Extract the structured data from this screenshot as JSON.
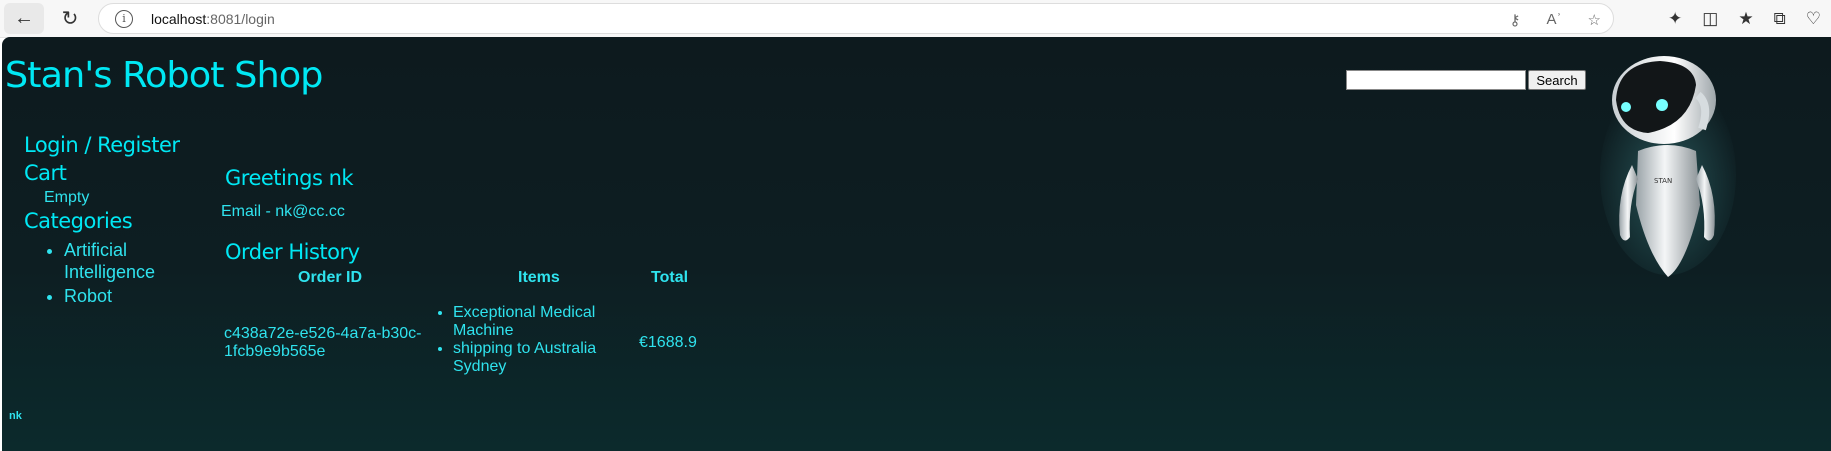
{
  "browser": {
    "url_host": "localhost",
    "url_rest": ":8081/login"
  },
  "site": {
    "title": "Stan's Robot Shop",
    "search_button": "Search",
    "search_value": ""
  },
  "sidebar": {
    "login": "Login / Register",
    "cart": "Cart",
    "cart_status": "Empty",
    "categories_heading": "Categories",
    "categories": [
      {
        "label": "Artificial Intelligence"
      },
      {
        "label": "Robot"
      }
    ]
  },
  "main": {
    "greeting": "Greetings nk",
    "email": "Email - nk@cc.cc",
    "order_history_heading": "Order History",
    "columns": {
      "order_id": "Order ID",
      "items": "Items",
      "total": "Total"
    },
    "orders": [
      {
        "order_id": "c438a72e-e526-4a7a-b30c-1fcb9e9b565e",
        "items": [
          "Exceptional Medical Machine",
          "shipping to Australia Sydney"
        ],
        "total": "€1688.9"
      }
    ]
  },
  "footer": {
    "user": "nk"
  },
  "colors": {
    "accent": "#00e8f4",
    "background": "#0d1a1e"
  }
}
